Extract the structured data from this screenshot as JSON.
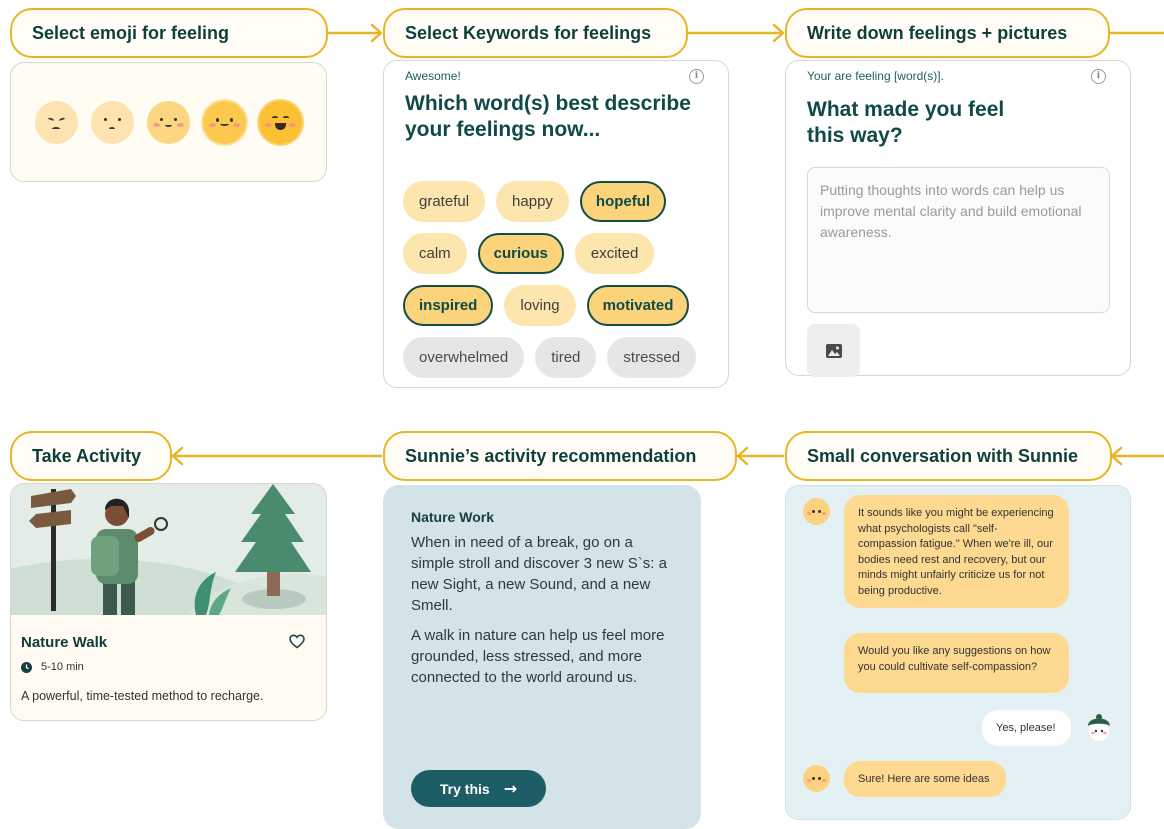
{
  "steps": {
    "emoji": "Select emoji for feeling",
    "keywords": "Select Keywords for feelings",
    "write": "Write down  feelings + pictures",
    "take": "Take Activity",
    "recommendation": "Sunnie’s activity recommendation",
    "conversation": "Small conversation with Sunnie"
  },
  "emoji_card": {
    "faces": [
      "very-sad-face-icon",
      "sad-face-icon",
      "neutral-face-icon",
      "happy-face-icon",
      "very-happy-face-icon"
    ]
  },
  "keyword_card": {
    "mood_label": "Awesome!",
    "question": "Which word(s) best describe your feelings now...",
    "chips": [
      {
        "label": "grateful",
        "state": "positive"
      },
      {
        "label": "happy",
        "state": "positive"
      },
      {
        "label": "hopeful",
        "state": "selected"
      },
      {
        "label": "calm",
        "state": "positive"
      },
      {
        "label": "curious",
        "state": "selected"
      },
      {
        "label": "excited",
        "state": "positive"
      },
      {
        "label": "inspired",
        "state": "selected"
      },
      {
        "label": "loving",
        "state": "positive"
      },
      {
        "label": "motivated",
        "state": "selected"
      },
      {
        "label": "overwhelmed",
        "state": "negative"
      },
      {
        "label": "tired",
        "state": "negative"
      },
      {
        "label": "stressed",
        "state": "negative"
      }
    ]
  },
  "write_card": {
    "feeling_label": "Your are feeling [word(s)].",
    "question_line1": "What made you feel",
    "question_line2": "this way?",
    "placeholder": "Putting thoughts into words can help us improve mental clarity and build emotional awareness."
  },
  "activity_card": {
    "title": "Nature Walk",
    "duration": "5-10 min",
    "description": "A powerful, time-tested method to recharge."
  },
  "recommendation_card": {
    "title": "Nature Work",
    "paragraph1": "When in need of a break, go on a simple stroll and discover 3 new S`s: a new Sight, a new Sound, and a new Smell.",
    "paragraph2": "A walk in nature can help us feel more grounded, less stressed, and more connected to the world around us.",
    "button": "Try this",
    "button_arrow": "→"
  },
  "conversation_card": {
    "messages": [
      {
        "from": "sunnie",
        "text": "It sounds like you might be experiencing what psychologists call \"self-compassion fatigue.\" When we're ill, our bodies need rest and recovery, but our minds might unfairly criticize us for not being productive."
      },
      {
        "from": "sunnie",
        "text": "Would you like any suggestions on how you could cultivate self-compassion?"
      },
      {
        "from": "user",
        "text": "Yes, please!"
      },
      {
        "from": "sunnie",
        "text": "Sure! Here are some ideas"
      }
    ]
  },
  "colors": {
    "accent_yellow": "#e8b524",
    "dark_green": "#0f4a46",
    "chip_positive": "#fde6ad",
    "chip_selected": "#fbd37a",
    "chip_negative": "#e6e6e6",
    "rec_bg": "#d4e3e7",
    "button": "#1d5e66"
  }
}
